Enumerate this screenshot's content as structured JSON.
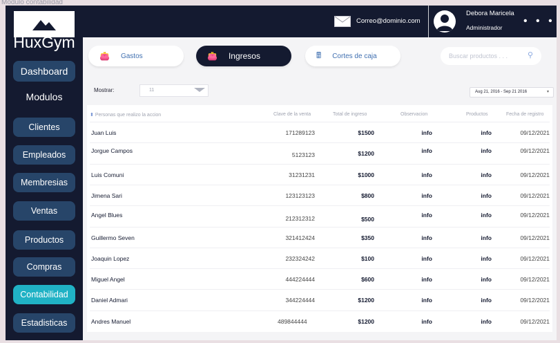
{
  "page_caption": "Modulo contabilidad",
  "brand": "HuxGym",
  "sidebar": {
    "dashboard": "Dashboard",
    "modulos": "Modulos",
    "items": [
      {
        "label": "Clientes"
      },
      {
        "label": "Empleados"
      },
      {
        "label": "Membresias"
      },
      {
        "label": "Ventas"
      },
      {
        "label": "Productos"
      },
      {
        "label": "Compras"
      },
      {
        "label": "Contabilidad",
        "active": true
      },
      {
        "label": "Estadisticas"
      }
    ]
  },
  "topbar": {
    "email": "Correo@dominio.com",
    "user_name": "Debora Maricela",
    "user_role": "Administrador",
    "more": "• • •"
  },
  "tabs": [
    {
      "label": "Gastos",
      "icon": "money-bag-icon"
    },
    {
      "label": "Ingresos",
      "icon": "money-bag-icon",
      "active": true
    },
    {
      "label": "Cortes de caja",
      "icon": "cash-register-icon"
    }
  ],
  "search": {
    "placeholder": "Buscar productos . . ."
  },
  "filters": {
    "mostrar_label": "Mostrar:",
    "mostrar_value": "11",
    "date_range": "Aug 21, 2016 - Sep 21 2016"
  },
  "table": {
    "headers": [
      "Personas que realizo la accion",
      "Clave de la venta",
      "Total de ingreso",
      "Observacion",
      "Productos",
      "Fecha de registro"
    ],
    "rows": [
      {
        "persona": "Juan Luis",
        "clave": "171289123",
        "total": "$1500",
        "observacion": "info",
        "productos": "info",
        "fecha": "09/12/2021"
      },
      {
        "persona": "Jorgue Campos",
        "clave": "5123123",
        "total": "$1200",
        "observacion": "info",
        "productos": "info",
        "fecha": "09/12/2021"
      },
      {
        "persona": "Luis Comuni",
        "clave": "31231231",
        "total": "$1000",
        "observacion": "info",
        "productos": "info",
        "fecha": "09/12/2021"
      },
      {
        "persona": "Jimena Sari",
        "clave": "123123123",
        "total": "$800",
        "observacion": "info",
        "productos": "info",
        "fecha": "09/12/2021"
      },
      {
        "persona": "Angel Blues",
        "clave": "212312312",
        "total": "$500",
        "observacion": "info",
        "productos": "info",
        "fecha": "09/12/2021"
      },
      {
        "persona": "Guillermo Seven",
        "clave": "321412424",
        "total": "$350",
        "observacion": "info",
        "productos": "info",
        "fecha": "09/12/2021"
      },
      {
        "persona": "Joaquin Lopez",
        "clave": "232324242",
        "total": "$100",
        "observacion": "info",
        "productos": "info",
        "fecha": "09/12/2021"
      },
      {
        "persona": "Miguel Angel",
        "clave": "444224444",
        "total": "$600",
        "observacion": "info",
        "productos": "info",
        "fecha": "09/12/2021"
      },
      {
        "persona": "Daniel Admari",
        "clave": "344224444",
        "total": "$1200",
        "observacion": "info",
        "productos": "info",
        "fecha": "09/12/2021"
      },
      {
        "persona": "Andres Manuel",
        "clave": "489844444",
        "total": "$1200",
        "observacion": "info",
        "productos": "info",
        "fecha": "09/12/2021"
      }
    ]
  }
}
